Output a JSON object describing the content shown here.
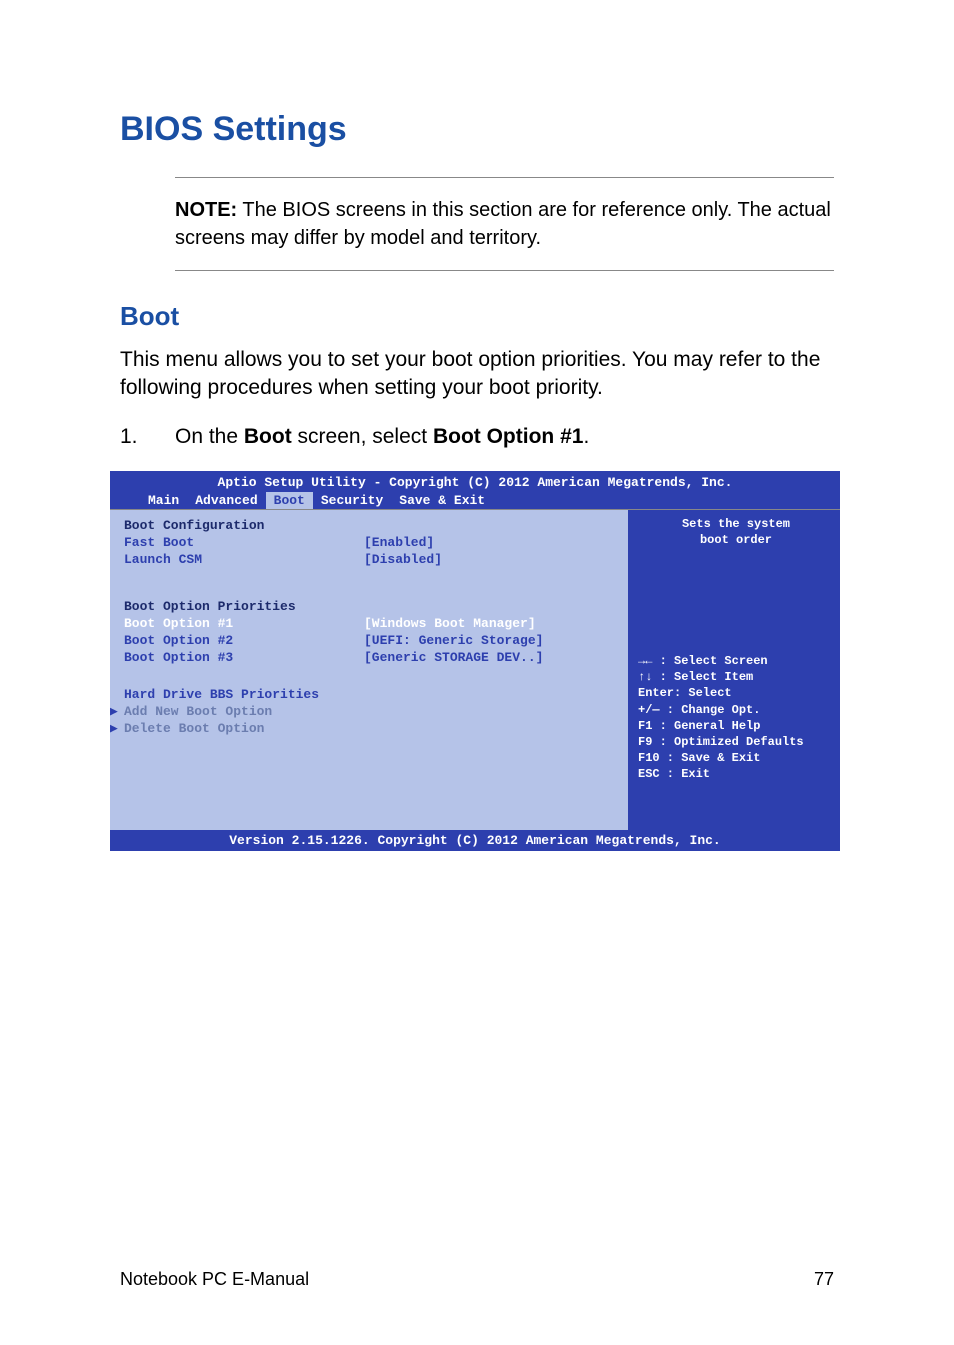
{
  "page": {
    "title": "BIOS Settings",
    "note_label": "NOTE:",
    "note_text": " The BIOS screens in this section are for reference only. The actual screens may differ by model and territory.",
    "section_heading": "Boot",
    "intro": "This menu allows you to set your boot option priorities. You may refer to the following procedures when setting your boot priority.",
    "step_num": "1.",
    "step_pre": "On the ",
    "step_b1": "Boot",
    "step_mid": " screen, select ",
    "step_b2": "Boot Option #1",
    "step_post": "."
  },
  "bios": {
    "header": "Aptio Setup Utility - Copyright (C) 2012 American Megatrends, Inc.",
    "tabs": [
      "Main",
      "Advanced",
      "Boot",
      "Security",
      "Save & Exit"
    ],
    "active_tab": "Boot",
    "left": {
      "h1": "Boot Configuration",
      "rows": [
        {
          "label": "Fast Boot",
          "value": "[Enabled]",
          "cls": ""
        },
        {
          "label": "Launch CSM",
          "value": "[Disabled]",
          "cls": ""
        }
      ],
      "h2": "Boot Option Priorities",
      "priorities": [
        {
          "label": "Boot Option #1",
          "value": "[Windows Boot Manager]",
          "cls": "bios-selected"
        },
        {
          "label": "Boot Option #2",
          "value": "[UEFI: Generic Storage]",
          "cls": ""
        },
        {
          "label": "Boot Option #3",
          "value": "[Generic STORAGE DEV..]",
          "cls": ""
        }
      ],
      "hdd": "Hard Drive BBS Priorities",
      "add": "Add New Boot Option",
      "del": "Delete Boot Option"
    },
    "right": {
      "top1": "Sets the system",
      "top2": "boot order",
      "help": [
        "→←   : Select Screen",
        "↑↓   : Select Item",
        "Enter: Select",
        "+/—  : Change Opt.",
        "F1   : General Help",
        "F9   : Optimized Defaults",
        "F10  : Save & Exit",
        "ESC  : Exit"
      ]
    },
    "footer": "Version 2.15.1226. Copyright (C) 2012 American Megatrends, Inc."
  },
  "footer": {
    "left": "Notebook PC E-Manual",
    "right": "77"
  }
}
